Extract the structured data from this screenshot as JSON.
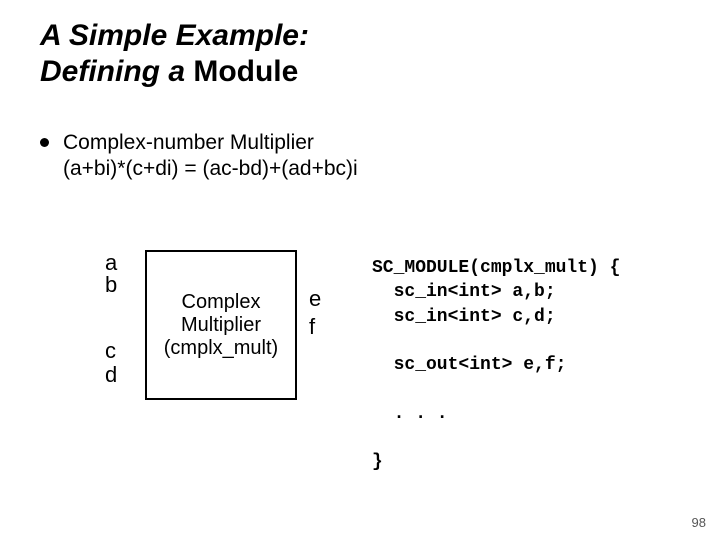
{
  "title": {
    "line1_italic": "A Simple Example:",
    "line2_italic_prefix": "Defining a ",
    "line2_normal": "Module"
  },
  "bullet": {
    "line1": "Complex-number Multiplier",
    "line2": "(a+bi)*(c+di) = (ac-bd)+(ad+bc)i"
  },
  "diagram": {
    "ports": {
      "a": "a",
      "b": "b",
      "c": "c",
      "d": "d",
      "e": "e",
      "f": "f"
    },
    "box": {
      "line1": "Complex",
      "line2": "Multiplier",
      "line3": "(cmplx_mult)"
    }
  },
  "code": {
    "l1": "SC_MODULE(cmplx_mult) {",
    "l2": "  sc_in<int> a,b;",
    "l3": "  sc_in<int> c,d;",
    "l4": "",
    "l5": "  sc_out<int> e,f;",
    "l6": "",
    "l7": "  . . .",
    "l8": "",
    "l9": "}"
  },
  "page_number": "98"
}
